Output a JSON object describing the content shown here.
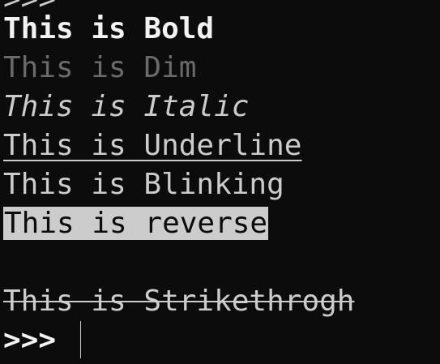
{
  "terminal": {
    "previous_line": ">>>",
    "lines": {
      "bold": "This is Bold",
      "dim": "This is Dim",
      "italic": "This is Italic",
      "underline": "This is Underline",
      "blinking": "This is Blinking",
      "reverse": "This is reverse",
      "empty": "",
      "strikethrough": "This is Strikethrogh"
    },
    "prompt": ">>> "
  },
  "colors": {
    "background": "#0c0c0c",
    "foreground": "#cccccc",
    "bright": "#f2f2f2",
    "dim": "#6a6a6a",
    "reverse_bg": "#cccccc"
  }
}
